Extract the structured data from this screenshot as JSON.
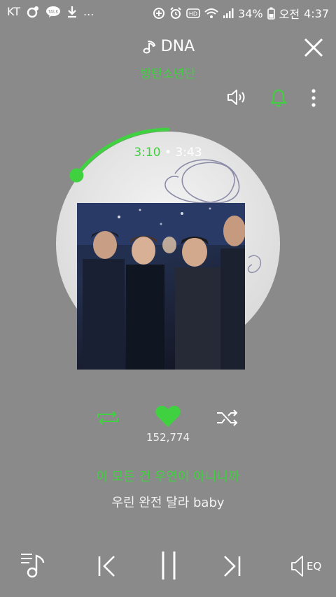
{
  "status": {
    "carrier": "KT",
    "notif_icons": [
      "chat-bubble-icon",
      "kakaotalk-icon",
      "download-icon"
    ],
    "more": "...",
    "battery": "34%",
    "ampm": "오전",
    "time": "4:37"
  },
  "track": {
    "title": "DNA",
    "artist": "방탄소년단",
    "current_time": "3:10",
    "separator": "•",
    "total_time": "3:43",
    "progress": 0.852,
    "like_count": "152,774"
  },
  "lyrics": {
    "current": "이 모든 건 우연이 아니니까",
    "next": "우린 완전 달라 baby"
  },
  "eq_label": "EQ",
  "colors": {
    "accent": "#3fd13f",
    "background": "#8a8a8a"
  }
}
